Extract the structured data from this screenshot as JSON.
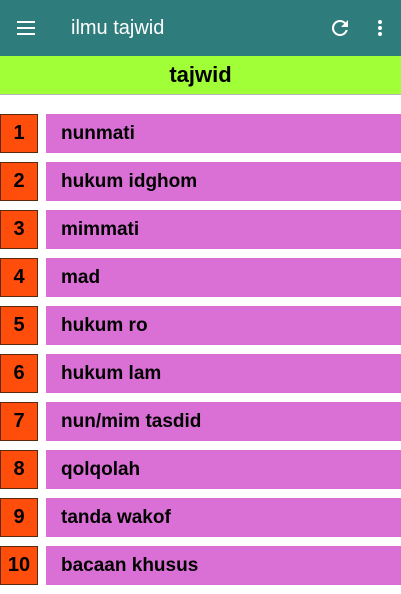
{
  "appbar": {
    "title": "ilmu tajwid",
    "icons": {
      "menu": "menu-icon",
      "refresh": "refresh-icon",
      "more": "more-vert-icon"
    },
    "color": "#2e7c7c"
  },
  "header": {
    "title": "tajwid",
    "color": "#a1ff38"
  },
  "colors": {
    "number_bg": "#ff4d0b",
    "item_bg": "#da70d6"
  },
  "items": [
    {
      "num": "1",
      "label": "nunmati"
    },
    {
      "num": "2",
      "label": "hukum idghom"
    },
    {
      "num": "3",
      "label": "mimmati"
    },
    {
      "num": "4",
      "label": "mad"
    },
    {
      "num": "5",
      "label": "hukum ro"
    },
    {
      "num": "6",
      "label": "hukum lam"
    },
    {
      "num": "7",
      "label": "nun/mim tasdid"
    },
    {
      "num": "8",
      "label": "qolqolah"
    },
    {
      "num": "9",
      "label": "tanda wakof"
    },
    {
      "num": "10",
      "label": "bacaan khusus"
    }
  ]
}
